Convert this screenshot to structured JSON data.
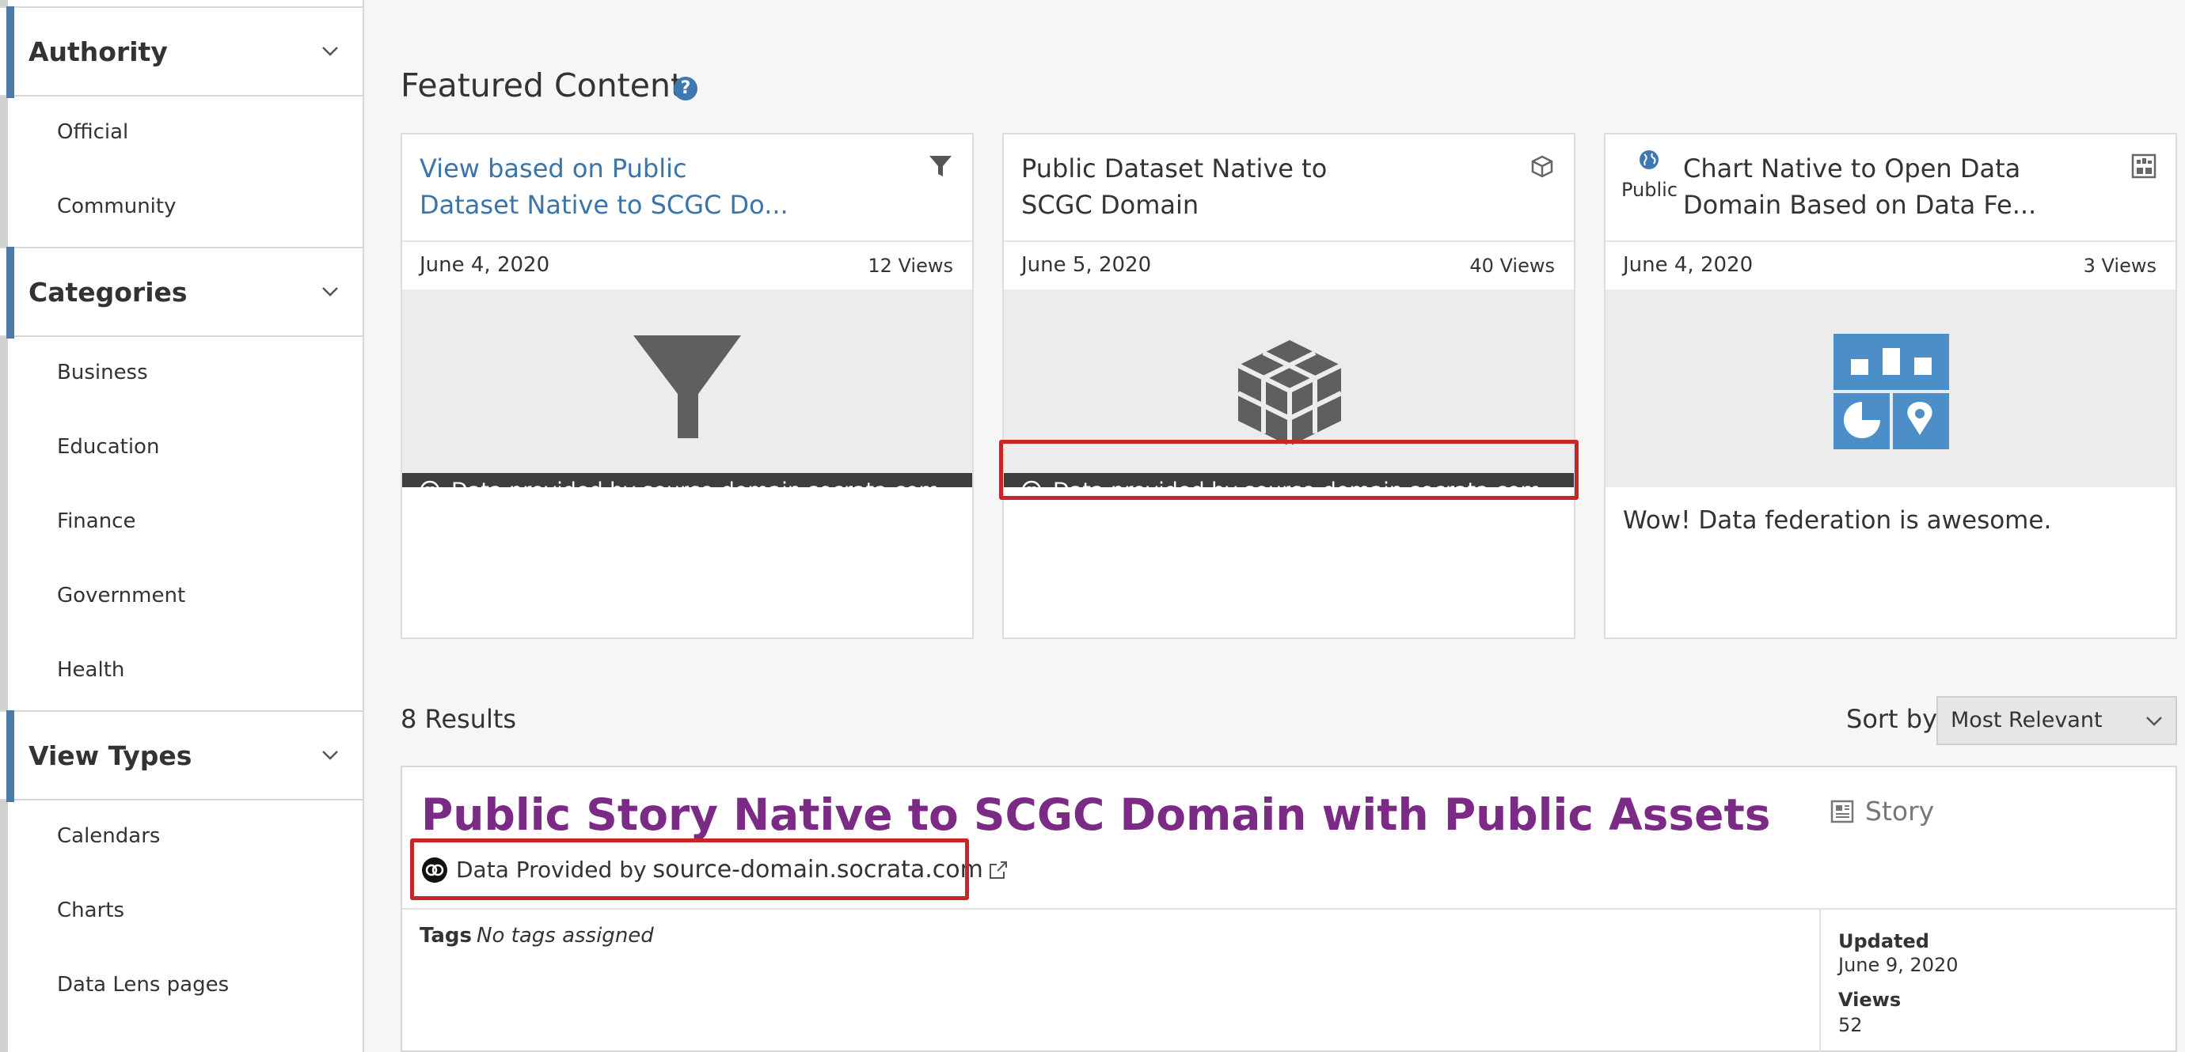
{
  "sidebar": {
    "sections": [
      {
        "title": "Authority",
        "items": [
          "Official",
          "Community"
        ]
      },
      {
        "title": "Categories",
        "items": [
          "Business",
          "Education",
          "Finance",
          "Government",
          "Health"
        ]
      },
      {
        "title": "View Types",
        "items": [
          "Calendars",
          "Charts",
          "Data Lens pages"
        ]
      }
    ]
  },
  "featured": {
    "title": "Featured Content",
    "help_icon": "?",
    "cards": [
      {
        "title_line1": "View based on Public",
        "title_line2": "Dataset Native to SCGC Do...",
        "type_icon": "filter-icon",
        "date": "June 4, 2020",
        "views": "12 Views",
        "provided_label": "Data provided by",
        "provided_domain": "source-domain.socrata.com"
      },
      {
        "title_line1": "Public Dataset Native to",
        "title_line2": "SCGC Domain",
        "type_icon": "dataset-icon",
        "date": "June 5, 2020",
        "views": "40 Views",
        "provided_label": "Data provided by",
        "provided_domain": "source-domain.socrata.com"
      },
      {
        "public_label": "Public",
        "title_line1": "Chart Native to Open Data",
        "title_line2": "Domain Based on Data Fe...",
        "type_icon": "chart-icon",
        "date": "June 4, 2020",
        "views": "3 Views",
        "description": "Wow! Data federation is awesome."
      }
    ]
  },
  "results": {
    "count": "8 Results",
    "sort_label": "Sort by",
    "sort_value": "Most Relevant",
    "items": [
      {
        "title": "Public Story Native to SCGC Domain with Public Assets",
        "type": "Story",
        "provided_label": "Data Provided by",
        "provided_domain": "source-domain.socrata.com",
        "tags_label": "Tags",
        "tags_value": "No tags assigned",
        "updated_label": "Updated",
        "updated_value": "June 9, 2020",
        "views_label": "Views",
        "views_value": "52"
      }
    ]
  },
  "colors": {
    "accent_blue": "#3a74ab",
    "story_title": "#7b2a86",
    "highlight": "#c62626",
    "chart_tile": "#4c8ec8"
  }
}
